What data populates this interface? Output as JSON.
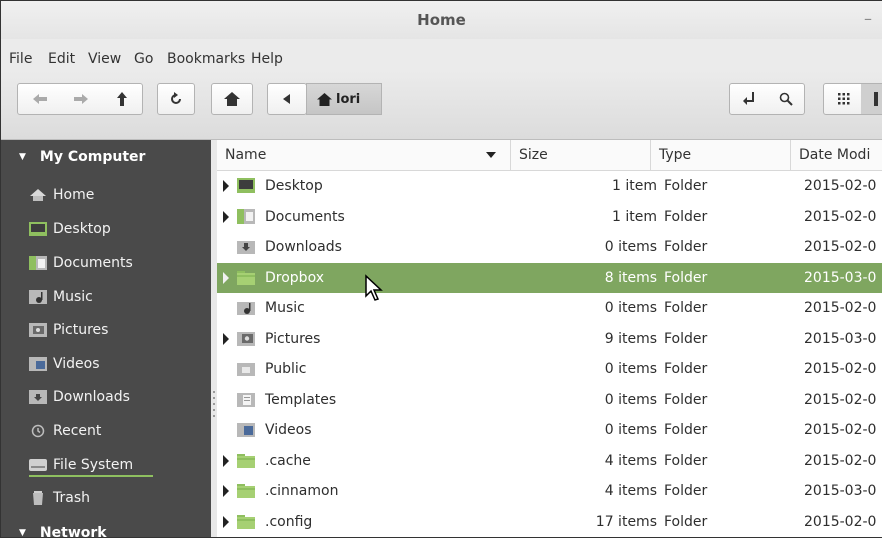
{
  "window": {
    "title": "Home",
    "minimize_glyph": "–"
  },
  "menubar": [
    "File",
    "Edit",
    "View",
    "Go",
    "Bookmarks",
    "Help"
  ],
  "toolbar": {
    "breadcrumb_current": "lori",
    "icons": [
      "back-arrow-icon",
      "forward-arrow-icon",
      "up-arrow-icon",
      "reload-icon",
      "home-icon",
      "breadcrumb-left-icon",
      "open-location-icon",
      "search-icon",
      "icon-view-icon"
    ]
  },
  "sidebar": {
    "sections": [
      {
        "title": "My Computer",
        "items": [
          "Home",
          "Desktop",
          "Documents",
          "Music",
          "Pictures",
          "Videos",
          "Downloads",
          "Recent",
          "File System",
          "Trash"
        ]
      },
      {
        "title": "Network",
        "items": []
      }
    ]
  },
  "columns": [
    "Name",
    "Size",
    "Type",
    "Date Modi"
  ],
  "files": [
    {
      "name": "Desktop",
      "size": "1 item",
      "type": "Folder",
      "date": "2015-02-0",
      "expander": true,
      "icon": "desktop-folder-icon"
    },
    {
      "name": "Documents",
      "size": "1 item",
      "type": "Folder",
      "date": "2015-02-0",
      "expander": true,
      "icon": "documents-folder-icon"
    },
    {
      "name": "Downloads",
      "size": "0 items",
      "type": "Folder",
      "date": "2015-02-0",
      "expander": false,
      "icon": "downloads-folder-icon"
    },
    {
      "name": "Dropbox",
      "size": "8 items",
      "type": "Folder",
      "date": "2015-03-0",
      "expander": true,
      "icon": "folder-icon",
      "selected": true
    },
    {
      "name": "Music",
      "size": "0 items",
      "type": "Folder",
      "date": "2015-02-0",
      "expander": false,
      "icon": "music-folder-icon"
    },
    {
      "name": "Pictures",
      "size": "9 items",
      "type": "Folder",
      "date": "2015-03-0",
      "expander": true,
      "icon": "pictures-folder-icon"
    },
    {
      "name": "Public",
      "size": "0 items",
      "type": "Folder",
      "date": "2015-02-0",
      "expander": false,
      "icon": "public-folder-icon"
    },
    {
      "name": "Templates",
      "size": "0 items",
      "type": "Folder",
      "date": "2015-02-0",
      "expander": false,
      "icon": "templates-folder-icon"
    },
    {
      "name": "Videos",
      "size": "0 items",
      "type": "Folder",
      "date": "2015-02-0",
      "expander": false,
      "icon": "videos-folder-icon"
    },
    {
      "name": ".cache",
      "size": "4 items",
      "type": "Folder",
      "date": "2015-02-0",
      "expander": true,
      "icon": "folder-icon"
    },
    {
      "name": ".cinnamon",
      "size": "4 items",
      "type": "Folder",
      "date": "2015-03-0",
      "expander": true,
      "icon": "folder-icon"
    },
    {
      "name": ".config",
      "size": "17 items",
      "type": "Folder",
      "date": "2015-02-0",
      "expander": true,
      "icon": "folder-icon"
    }
  ],
  "colors": {
    "selection": "#7fa660",
    "sidebar_bg": "#4a4a4a",
    "folder_green": "#8fbf5f"
  }
}
